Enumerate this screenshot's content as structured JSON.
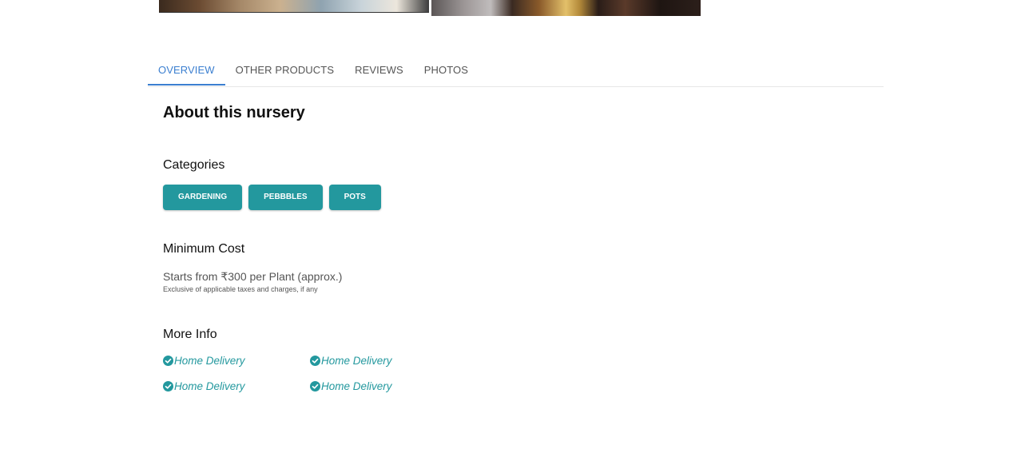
{
  "tabs": [
    {
      "label": "OVERVIEW",
      "active": true
    },
    {
      "label": "OTHER PRODUCTS",
      "active": false
    },
    {
      "label": "REVIEWS",
      "active": false
    },
    {
      "label": "PHOTOS",
      "active": false
    }
  ],
  "about": {
    "heading": "About this nursery"
  },
  "categories": {
    "title": "Categories",
    "chips": [
      "GARDENING",
      "PEBBBLES",
      "POTS"
    ]
  },
  "min_cost": {
    "title": "Minimum Cost",
    "text": "Starts from ₹300 per Plant (approx.)",
    "note": "Exclusive of applicable taxes and charges, if any"
  },
  "more_info": {
    "title": "More Info",
    "items": [
      "Home Delivery",
      "Home Delivery",
      "Home Delivery",
      "Home Delivery"
    ],
    "icon": "check-circle-icon"
  },
  "colors": {
    "accent_teal": "#23989e",
    "tab_active_blue": "#3b7fd0"
  }
}
